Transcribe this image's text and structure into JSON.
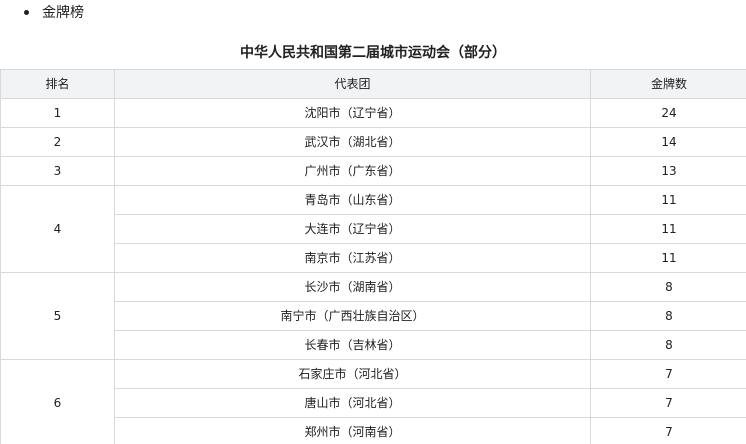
{
  "section": {
    "bullet_label": "金牌榜"
  },
  "table": {
    "caption": "中华人民共和国第二届城市运动会（部分）",
    "headers": {
      "rank": "排名",
      "team": "代表团",
      "gold": "金牌数"
    },
    "groups": [
      {
        "rank": "1",
        "rows": [
          {
            "team": "沈阳市（辽宁省）",
            "gold": "24"
          }
        ]
      },
      {
        "rank": "2",
        "rows": [
          {
            "team": "武汉市（湖北省）",
            "gold": "14"
          }
        ]
      },
      {
        "rank": "3",
        "rows": [
          {
            "team": "广州市（广东省）",
            "gold": "13"
          }
        ]
      },
      {
        "rank": "4",
        "rows": [
          {
            "team": "青岛市（山东省）",
            "gold": "11"
          },
          {
            "team": "大连市（辽宁省）",
            "gold": "11"
          },
          {
            "team": "南京市（江苏省）",
            "gold": "11"
          }
        ]
      },
      {
        "rank": "5",
        "rows": [
          {
            "team": "长沙市（湖南省）",
            "gold": "8"
          },
          {
            "team": "南宁市（广西壮族自治区）",
            "gold": "8"
          },
          {
            "team": "长春市（吉林省）",
            "gold": "8"
          }
        ]
      },
      {
        "rank": "6",
        "rows": [
          {
            "team": "石家庄市（河北省）",
            "gold": "7"
          },
          {
            "team": "唐山市（河北省）",
            "gold": "7"
          },
          {
            "team": "郑州市（河南省）",
            "gold": "7"
          }
        ]
      }
    ]
  }
}
